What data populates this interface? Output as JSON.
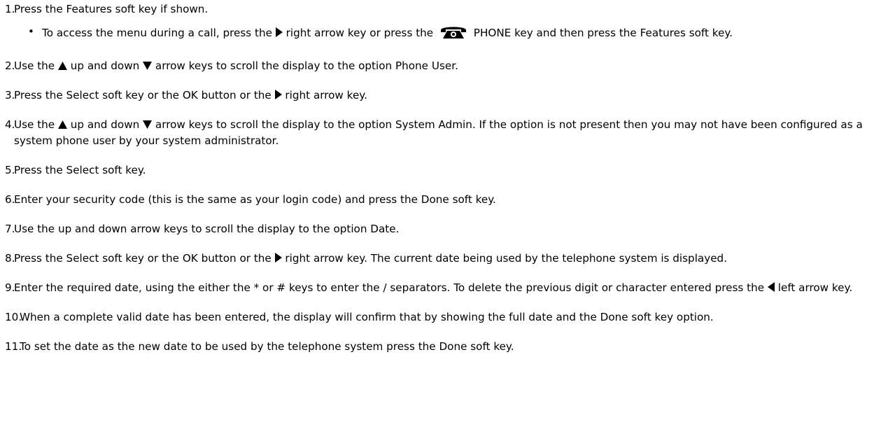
{
  "steps": [
    {
      "num": "1.",
      "parts": [
        "Press the Features soft key if shown."
      ],
      "bullets": [
        {
          "parts": [
            "To access the menu during a call, press the ",
            " right arrow key or press the ",
            " PHONE key and then press the Features soft key."
          ]
        }
      ]
    },
    {
      "num": "2.",
      "parts": [
        "Use the ",
        " up and down ",
        " arrow keys to scroll the display to the option Phone User."
      ]
    },
    {
      "num": "3.",
      "parts": [
        "Press the Select soft key or the OK button or the ",
        " right arrow key."
      ]
    },
    {
      "num": "4.",
      "parts": [
        "Use the ",
        " up and down ",
        " arrow keys to scroll the display to the option System Admin. If the option is not present then you may not have been configured as a system phone user by your system administrator."
      ]
    },
    {
      "num": "5.",
      "parts": [
        "Press the Select soft key."
      ]
    },
    {
      "num": "6.",
      "parts": [
        "Enter your security code (this is the same as your login code) and press the Done soft key."
      ]
    },
    {
      "num": "7.",
      "parts": [
        "Use the up and down arrow keys to scroll the display to the option Date."
      ]
    },
    {
      "num": "8.",
      "parts": [
        "Press the Select soft key or the OK button or the ",
        " right arrow key. The current date being used by the telephone system is displayed."
      ]
    },
    {
      "num": "9.",
      "parts": [
        "Enter the required date, using the either the * or # keys to enter the / separators. To delete the previous digit or character entered press the ",
        " left arrow key."
      ]
    },
    {
      "num": "10.",
      "parts": [
        "When a complete valid date has been entered, the display will confirm that by showing the full date and the Done soft key option."
      ]
    },
    {
      "num": "11.",
      "parts": [
        "To set the date as the new date to be used by the telephone system press the Done soft key."
      ]
    }
  ],
  "icons": {
    "right_arrow": "right-arrow-key-icon",
    "left_arrow": "left-arrow-key-icon",
    "up_arrow": "up-arrow-key-icon",
    "down_arrow": "down-arrow-key-icon",
    "phone": "phone-key-icon"
  }
}
